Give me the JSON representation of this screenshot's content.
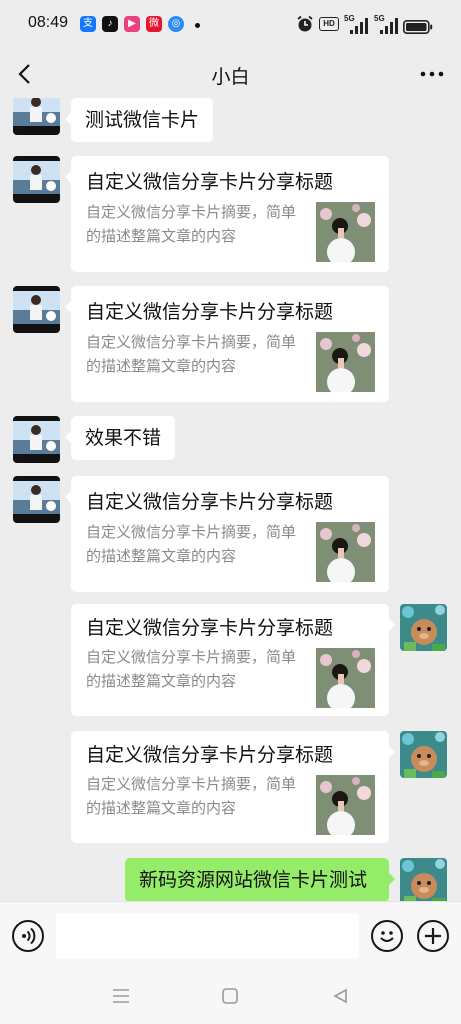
{
  "status_bar": {
    "time": "08:49",
    "app_icons": [
      {
        "name": "alipay-icon",
        "glyph": "支",
        "color": "#1677ff"
      },
      {
        "name": "tiktok-icon",
        "glyph": "♪",
        "color": "#111111"
      },
      {
        "name": "video-app-icon",
        "glyph": "▶",
        "color": "#e8437e"
      },
      {
        "name": "weibo-icon",
        "glyph": "微",
        "color": "#e6162d"
      },
      {
        "name": "browser-icon",
        "glyph": "◎",
        "color": "#2a8cf0"
      }
    ],
    "hd_label": "HD",
    "network_label_1": "5G",
    "network_label_2": "5G"
  },
  "nav": {
    "title": "小白",
    "back_icon": "chevron-left-icon",
    "more_icon": "more-dots-icon"
  },
  "messages": [
    {
      "type": "text",
      "side": "left",
      "text": "测试微信卡片"
    },
    {
      "type": "card",
      "side": "left",
      "title": "自定义微信分享卡片分享标题",
      "desc": "自定义微信分享卡片摘要，简单的描述整篇文章的内容"
    },
    {
      "type": "card",
      "side": "left",
      "title": "自定义微信分享卡片分享标题",
      "desc": "自定义微信分享卡片摘要，简单的描述整篇文章的内容"
    },
    {
      "type": "text",
      "side": "left",
      "text": "效果不错"
    },
    {
      "type": "card",
      "side": "left",
      "title": "自定义微信分享卡片分享标题",
      "desc": "自定义微信分享卡片摘要，简单的描述整篇文章的内容"
    },
    {
      "type": "card",
      "side": "right",
      "title": "自定义微信分享卡片分享标题",
      "desc": "自定义微信分享卡片摘要，简单的描述整篇文章的内容"
    },
    {
      "type": "card",
      "side": "right",
      "title": "自定义微信分享卡片分享标题",
      "desc": "自定义微信分享卡片摘要，简单的描述整篇文章的内容"
    },
    {
      "type": "text",
      "side": "right",
      "text": "新码资源网站微信卡片测试"
    }
  ],
  "input_bar": {
    "voice_icon": "voice-icon",
    "emoji_icon": "emoji-icon",
    "plus_icon": "plus-icon",
    "placeholder": ""
  },
  "colors": {
    "background": "#ededed",
    "bubble_green": "#95ec69",
    "bubble_white": "#ffffff",
    "desc_gray": "#8a8a8a"
  }
}
